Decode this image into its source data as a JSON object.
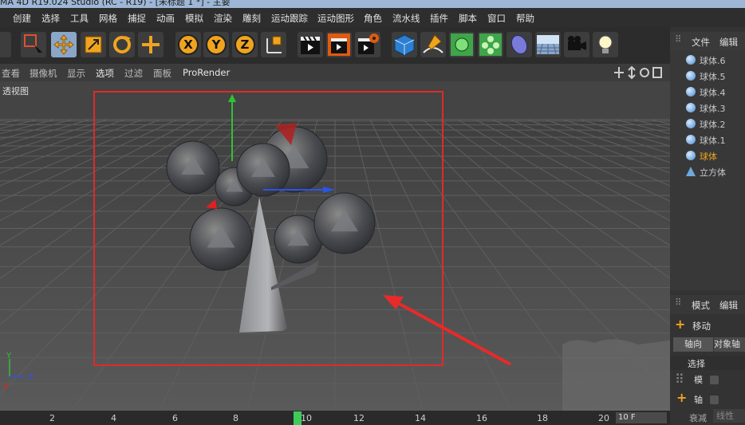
{
  "window": {
    "title": "MA 4D R19.024 Studio (RC - R19) - [未标题 1 *] - 主要"
  },
  "menu": [
    "创建",
    "选择",
    "工具",
    "网格",
    "捕捉",
    "动画",
    "模拟",
    "渲染",
    "雕刻",
    "运动跟踪",
    "运动图形",
    "角色",
    "流水线",
    "插件",
    "脚本",
    "窗口",
    "帮助"
  ],
  "viewport_menu": [
    "查看",
    "摄像机",
    "显示",
    "选项",
    "过滤",
    "面板",
    "ProRender"
  ],
  "viewport": {
    "label": "透视图"
  },
  "timeline": {
    "ticks": [
      "2",
      "4",
      "6",
      "8",
      "10",
      "12",
      "14",
      "16",
      "18",
      "20"
    ],
    "current_frame": "10",
    "frame_field": "10 F"
  },
  "object_panel": {
    "tabs": [
      "文件",
      "编辑"
    ],
    "items": [
      "球体.6",
      "球体.5",
      "球体.4",
      "球体.3",
      "球体.2",
      "球体.1",
      "球体",
      "立方体"
    ]
  },
  "attr_panel": {
    "tabs": [
      "模式",
      "编辑"
    ],
    "tool_name": "移动",
    "buttons": [
      "轴向",
      "对象轴"
    ],
    "select_label": "选择",
    "row_model": "模",
    "row_axis": "轴",
    "bottom": [
      "衰减",
      "线性"
    ]
  },
  "axis_labels": {
    "y": "Y",
    "z": "Z",
    "x": "X"
  },
  "colors": {
    "accent": "#f0a41e",
    "selected_tool": "#8aa6c9",
    "annotation": "#e03030"
  }
}
